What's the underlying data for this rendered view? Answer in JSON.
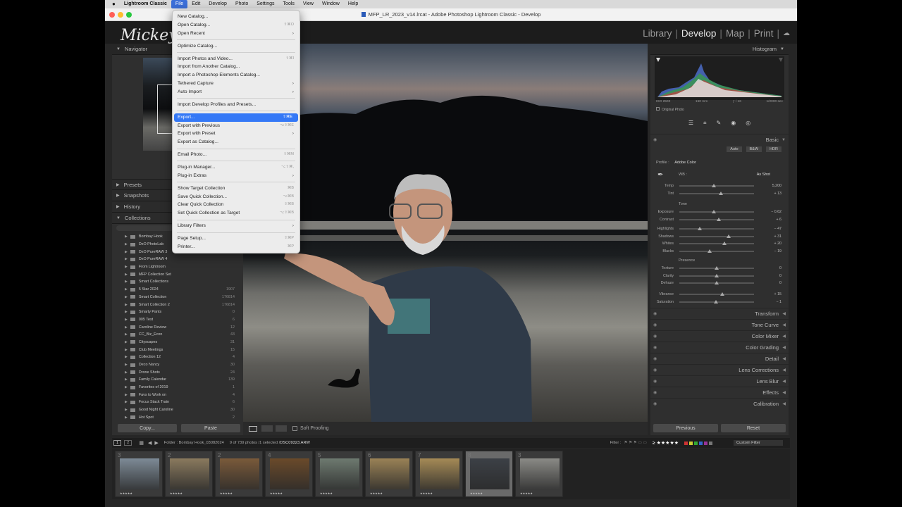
{
  "menubar": {
    "apple": "",
    "app": "Lightroom Classic",
    "items": [
      "File",
      "Edit",
      "Develop",
      "Photo",
      "Settings",
      "Tools",
      "View",
      "Window",
      "Help"
    ]
  },
  "window_title": "MFP_LR_2023_v14.lrcat - Adobe Photoshop Lightroom Classic - Develop",
  "identity_plate": "Mickey",
  "modules": [
    "Library",
    "Develop",
    "Map",
    "Print"
  ],
  "left_panel": {
    "navigator": "Navigator",
    "presets": "Presets",
    "snapshots": "Snapshots",
    "history": "History",
    "collections": "Collections",
    "collection_items": [
      {
        "name": "Bombay Hook",
        "count": ""
      },
      {
        "name": "DxO PhotoLab",
        "count": ""
      },
      {
        "name": "DxO PureRAW 3",
        "count": ""
      },
      {
        "name": "DxO PureRAW 4",
        "count": ""
      },
      {
        "name": "From Lightroom",
        "count": ""
      },
      {
        "name": "MFP Collection Set",
        "count": ""
      },
      {
        "name": "Smart Collections",
        "count": ""
      },
      {
        "name": "5 Star 2024",
        "count": "1907"
      },
      {
        "name": "Smart Collection",
        "count": "176814"
      },
      {
        "name": "Smart Collection 2",
        "count": "176814"
      },
      {
        "name": "Smarty Pants",
        "count": "0"
      },
      {
        "name": "005 Test",
        "count": "6"
      },
      {
        "name": "Caroline Review",
        "count": "12"
      },
      {
        "name": "CC_Biz_Econ",
        "count": "43"
      },
      {
        "name": "Cityscapes",
        "count": "31"
      },
      {
        "name": "Club Meetings",
        "count": "15"
      },
      {
        "name": "Collection 12",
        "count": "4"
      },
      {
        "name": "Deco Nancy",
        "count": "30"
      },
      {
        "name": "Drone Shots",
        "count": "24"
      },
      {
        "name": "Family Calendar",
        "count": "139"
      },
      {
        "name": "Favorites of 2019",
        "count": "1"
      },
      {
        "name": "Favs to Work on",
        "count": "4"
      },
      {
        "name": "Focus Stack Train",
        "count": "6"
      },
      {
        "name": "Good Night Caroline",
        "count": "30"
      },
      {
        "name": "Hot Spot",
        "count": "2"
      }
    ],
    "copy_btn": "Copy...",
    "paste_btn": "Paste"
  },
  "file_menu": {
    "groups": [
      [
        {
          "label": "New Catalog...",
          "sc": ""
        },
        {
          "label": "Open Catalog...",
          "sc": "⇧⌘O"
        },
        {
          "label": "Open Recent",
          "sub": true
        }
      ],
      [
        {
          "label": "Optimize Catalog...",
          "sc": ""
        }
      ],
      [
        {
          "label": "Import Photos and Video...",
          "sc": "⇧⌘I"
        },
        {
          "label": "Import from Another Catalog...",
          "sc": ""
        },
        {
          "label": "Import a Photoshop Elements Catalog...",
          "sc": ""
        },
        {
          "label": "Tethered Capture",
          "sub": true
        },
        {
          "label": "Auto Import",
          "sub": true
        }
      ],
      [
        {
          "label": "Import Develop Profiles and Presets...",
          "sc": ""
        }
      ],
      [
        {
          "label": "Export...",
          "sc": "⇧⌘E",
          "hl": true
        },
        {
          "label": "Export with Previous",
          "sc": "⌥⇧⌘E"
        },
        {
          "label": "Export with Preset",
          "sub": true
        },
        {
          "label": "Export as Catalog...",
          "sc": ""
        }
      ],
      [
        {
          "label": "Email Photo...",
          "sc": "⇧⌘M"
        }
      ],
      [
        {
          "label": "Plug-in Manager...",
          "sc": "⌥⇧⌘,"
        },
        {
          "label": "Plug-in Extras",
          "sub": true
        }
      ],
      [
        {
          "label": "Show Target Collection",
          "sc": "⌘B"
        },
        {
          "label": "Save Quick Collection...",
          "sc": "⌥⌘B"
        },
        {
          "label": "Clear Quick Collection",
          "sc": "⇧⌘B"
        },
        {
          "label": "Set Quick Collection as Target",
          "sc": "⌥⇧⌘B"
        }
      ],
      [
        {
          "label": "Library Filters",
          "sub": true
        }
      ],
      [
        {
          "label": "Page Setup...",
          "sc": "⇧⌘P"
        },
        {
          "label": "Printer...",
          "sc": "⌘P"
        }
      ]
    ]
  },
  "right_panel": {
    "histogram": "Histogram",
    "hist_info": [
      "ISO 2500",
      "150 mm",
      "ƒ / 16",
      "1/2000 sec"
    ],
    "original_photo": "Original Photo",
    "basic": "Basic",
    "treatment": [
      "Auto",
      "B&W",
      "HDR"
    ],
    "profile_label": "Profile :",
    "profile_value": "Adobe Color",
    "wb_label": "WB :",
    "wb_value": "As Shot",
    "tone_label": "Tone",
    "presence_label": "Presence",
    "wb_sliders": [
      {
        "label": "Temp",
        "value": "5,200",
        "pos": 0.46
      },
      {
        "label": "Tint",
        "value": "+ 13",
        "pos": 0.56
      }
    ],
    "tone_sliders": [
      {
        "label": "Exposure",
        "value": "− 0.62",
        "pos": 0.46
      },
      {
        "label": "Contrast",
        "value": "+ 6",
        "pos": 0.53
      }
    ],
    "tone_sliders2": [
      {
        "label": "Highlights",
        "value": "− 47",
        "pos": 0.27
      },
      {
        "label": "Shadows",
        "value": "+ 31",
        "pos": 0.66
      },
      {
        "label": "Whites",
        "value": "+ 20",
        "pos": 0.6
      },
      {
        "label": "Blacks",
        "value": "− 19",
        "pos": 0.41
      }
    ],
    "presence_sliders": [
      {
        "label": "Texture",
        "value": "0",
        "pos": 0.5
      },
      {
        "label": "Clarity",
        "value": "0",
        "pos": 0.5
      },
      {
        "label": "Dehaze",
        "value": "0",
        "pos": 0.5
      }
    ],
    "presence_sliders2": [
      {
        "label": "Vibrance",
        "value": "+ 15",
        "pos": 0.58
      },
      {
        "label": "Saturation",
        "value": "− 1",
        "pos": 0.49
      }
    ],
    "sections": [
      "Transform",
      "Tone Curve",
      "Color Mixer",
      "Color Grading",
      "Detail",
      "Lens Corrections",
      "Lens Blur",
      "Effects",
      "Calibration"
    ],
    "previous_btn": "Previous",
    "reset_btn": "Reset"
  },
  "center_toolbar": {
    "soft_proofing": "Soft Proofing"
  },
  "filmstrip_bar": {
    "page1": "1",
    "page2": "2",
    "folder": "Folder : Bombay Hook_03082024",
    "count": "9 of 739 photos /1 selected /",
    "file": "DSC09323.ARW",
    "filter": "Filter :",
    "rating": "≥ ★★★★★",
    "custom_filter": "Custom Filter"
  },
  "thumbnails": [
    {
      "num": "3",
      "color": "#7d8a96"
    },
    {
      "num": "2",
      "color": "#8a7a5e"
    },
    {
      "num": "2",
      "color": "#7a5a3a"
    },
    {
      "num": "4",
      "color": "#6a4a2a"
    },
    {
      "num": "5",
      "color": "#6e7a70"
    },
    {
      "num": "6",
      "color": "#9a8256"
    },
    {
      "num": "7",
      "color": "#a58a56"
    },
    {
      "num": "8",
      "color": "#3c4046"
    },
    {
      "num": "3",
      "color": "#8a8a86"
    }
  ]
}
